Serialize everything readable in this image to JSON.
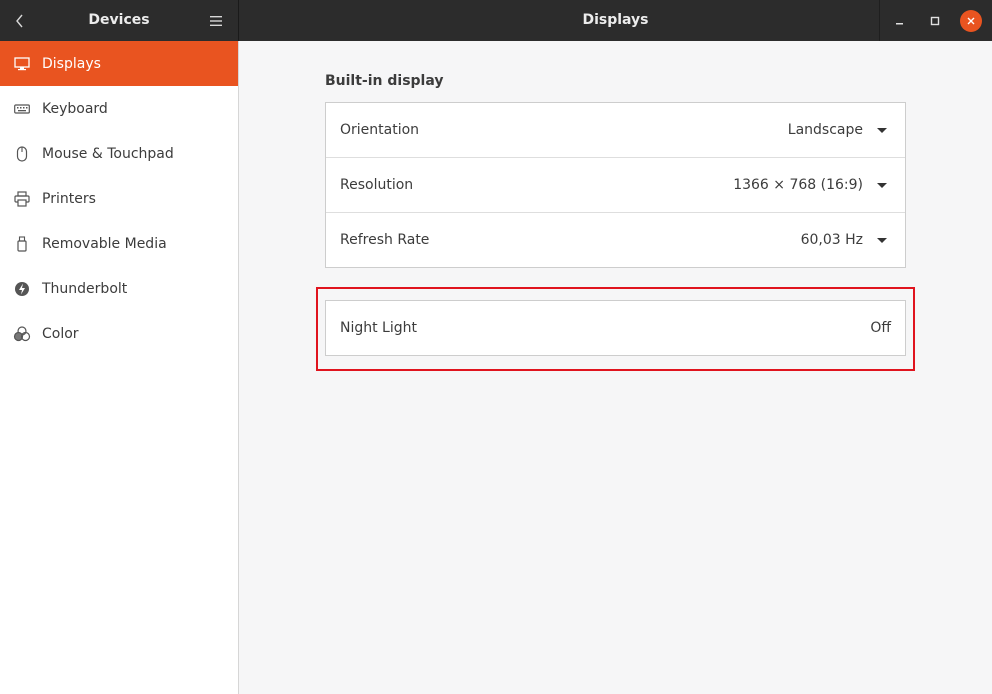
{
  "header": {
    "left_title": "Devices",
    "right_title": "Displays"
  },
  "sidebar": {
    "items": [
      {
        "label": "Displays",
        "icon": "display-icon",
        "active": true
      },
      {
        "label": "Keyboard",
        "icon": "keyboard-icon",
        "active": false
      },
      {
        "label": "Mouse & Touchpad",
        "icon": "mouse-icon",
        "active": false
      },
      {
        "label": "Printers",
        "icon": "printer-icon",
        "active": false
      },
      {
        "label": "Removable Media",
        "icon": "usb-drive-icon",
        "active": false
      },
      {
        "label": "Thunderbolt",
        "icon": "thunderbolt-icon",
        "active": false
      },
      {
        "label": "Color",
        "icon": "color-icon",
        "active": false
      }
    ]
  },
  "main": {
    "section_title": "Built-in display",
    "rows": [
      {
        "label": "Orientation",
        "value": "Landscape"
      },
      {
        "label": "Resolution",
        "value": "1366 × 768 (16:9)"
      },
      {
        "label": "Refresh Rate",
        "value": "60,03 Hz"
      }
    ],
    "night_light": {
      "label": "Night Light",
      "value": "Off"
    }
  },
  "colors": {
    "accent": "#e95420",
    "headerbar": "#2c2c2c",
    "highlight": "#e0141e"
  }
}
